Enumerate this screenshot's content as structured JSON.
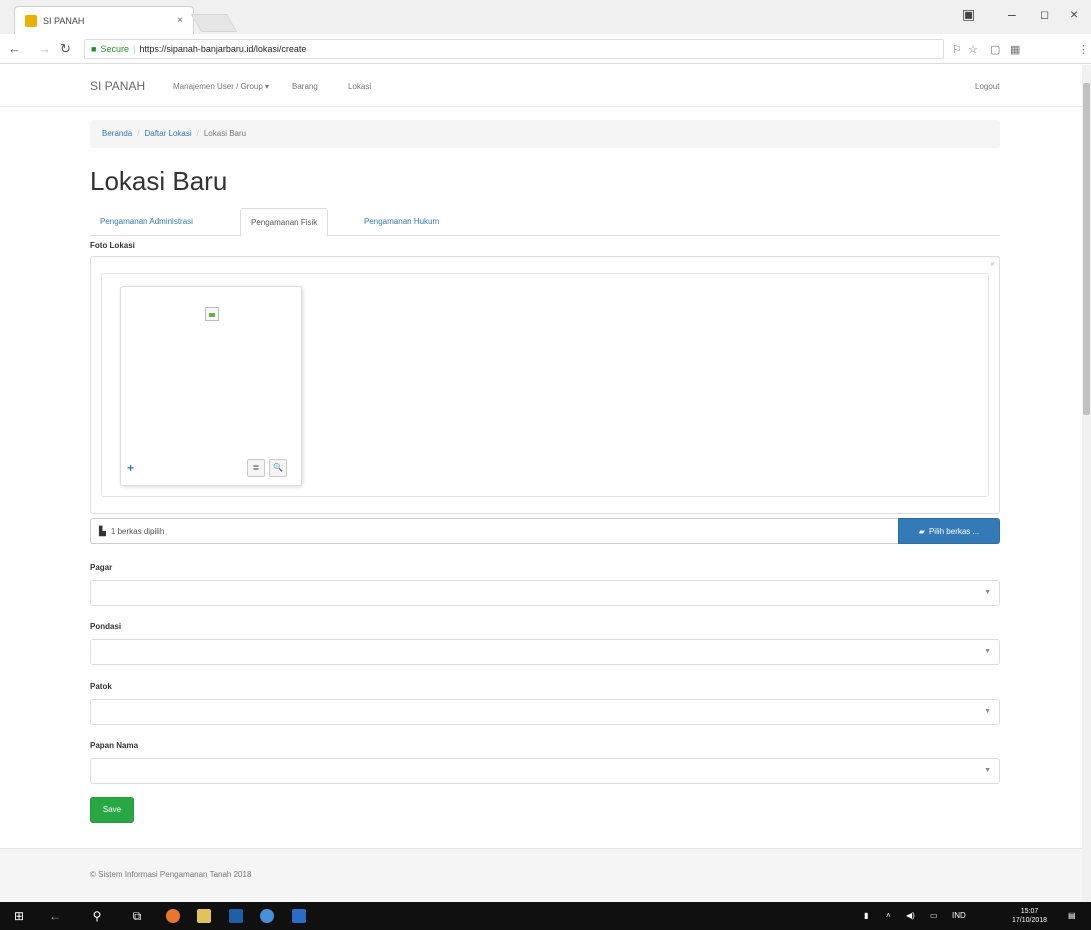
{
  "browser": {
    "tab_title": "SI PANAH",
    "tab_close": "×",
    "secure_label": "Secure",
    "url": "https://sipanah-banjarbaru.id/lokasi/create"
  },
  "navbar": {
    "brand": "SI PANAH",
    "items": [
      {
        "label": "Manajemen User / Group ▾"
      },
      {
        "label": "Barang"
      },
      {
        "label": "Lokasi"
      }
    ],
    "logout": "Logout"
  },
  "breadcrumb": {
    "items": [
      "Beranda",
      "Daftar Lokasi"
    ],
    "active": "Lokasi Baru",
    "separator": "/"
  },
  "page_title": "Lokasi Baru",
  "tabs": [
    {
      "label": "Pengamanan Administrasi",
      "active": false
    },
    {
      "label": "Pengamanan Fisik",
      "active": true
    },
    {
      "label": "Pengamanan Hukum",
      "active": false
    }
  ],
  "foto": {
    "label": "Foto Lokasi",
    "close_glyph": "×",
    "add_glyph": "+",
    "delete_glyph": "≣",
    "zoom_glyph": "🔍",
    "file_status": "1 berkas dipilih",
    "browse_label": "Pilih berkas ..."
  },
  "fields": [
    {
      "label": "Pagar",
      "value": ""
    },
    {
      "label": "Pondasi",
      "value": ""
    },
    {
      "label": "Patok",
      "value": ""
    },
    {
      "label": "Papan Nama",
      "value": ""
    }
  ],
  "save_label": "Save",
  "footer": "© Sistem Informasi Pengamanan Tanah 2018",
  "taskbar": {
    "time": "15:07",
    "date": "17/10/2018",
    "lang": "IND"
  },
  "colors": {
    "primary": "#337ab7",
    "success": "#28a745",
    "taskbar": "#101010"
  }
}
